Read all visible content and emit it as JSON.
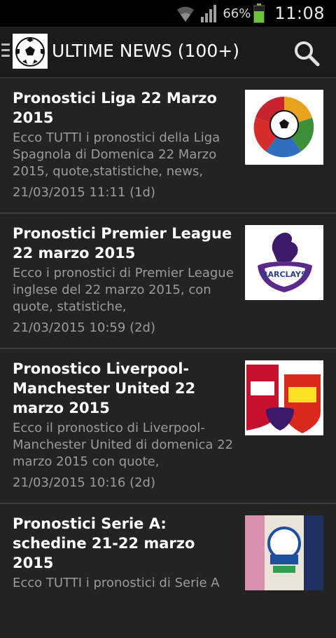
{
  "status_bar": {
    "battery_percent": "66%",
    "time": "11:08",
    "icons": [
      "wifi-icon",
      "signal-icon",
      "battery-icon"
    ]
  },
  "action_bar": {
    "title": "ULTIME NEWS (100+)",
    "icons": [
      "menu-icon",
      "football-logo",
      "search-icon"
    ]
  },
  "news": [
    {
      "title": "Pronostici Liga 22 Marzo 2015",
      "excerpt": "Ecco TUTTI i pronostici della Liga Spagnola di Domenica 22 Marzo 2015, quote,statistiche, news,",
      "date": "21/03/2015 11:11 (1d)",
      "thumbnail": "liga-logo"
    },
    {
      "title": "Pronostici Premier League 22 marzo 2015",
      "excerpt": "Ecco i pronostici di Premier League inglese del 22 marzo 2015, con quote, statistiche,",
      "date": "21/03/2015 10:59 (2d)",
      "thumbnail": "premier-league-logo",
      "thumb_text": "BARCLAYS"
    },
    {
      "title": "Pronostico Liverpool-Manchester United 22 marzo 2015",
      "excerpt": "Ecco il pronostico di Liverpool-Manchester United di domenica 22 marzo 2015 con quote,",
      "date": "21/03/2015 10:16 (2d)",
      "thumbnail": "liverpool-manutd-logos"
    },
    {
      "title": "Pronostici Serie A: schedine 21-22 marzo 2015",
      "excerpt": "Ecco TUTTI i pronostici di Serie A",
      "date": "",
      "thumbnail": "serie-a-logo"
    }
  ],
  "colors": {
    "background": "#232323",
    "status_bar": "#000000",
    "battery": "#6dc23a",
    "title_text": "#ffffff",
    "secondary_text": "#9b9b9b"
  }
}
